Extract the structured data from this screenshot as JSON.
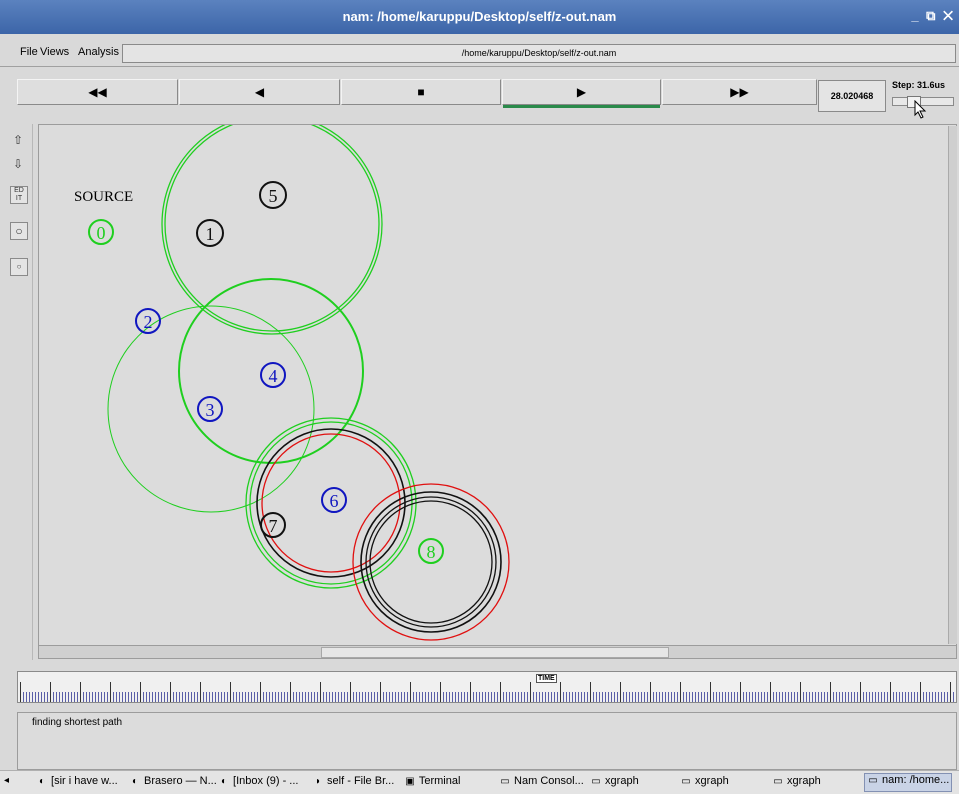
{
  "window": {
    "title": "nam: /home/karuppu/Desktop/self/z-out.nam",
    "controls": "_ ⧉ ✕"
  },
  "menubar": {
    "file": "File",
    "views": "Views",
    "analysis": "Analysis",
    "path": "/home/karuppu/Desktop/self/z-out.nam"
  },
  "controls": {
    "rewind": "◀◀",
    "back": "◀",
    "stop": "■",
    "play": "▶",
    "forward": "▶▶",
    "time": "28.020468",
    "step_label": "Step: 31.6us",
    "step_slider_fraction": 0.3
  },
  "tools": [
    "zoom-in-icon",
    "zoom-out-icon",
    "edit-icon",
    "node-tool-icon",
    "node-small-icon"
  ],
  "canvas": {
    "source_label": "SOURCE",
    "nodes": [
      {
        "id": "0",
        "color": "#1fcf1f"
      },
      {
        "id": "1",
        "color": "#000000"
      },
      {
        "id": "2",
        "color": "#1016c0"
      },
      {
        "id": "3",
        "color": "#1016c0"
      },
      {
        "id": "4",
        "color": "#1016c0"
      },
      {
        "id": "5",
        "color": "#000000"
      },
      {
        "id": "6",
        "color": "#1016c0"
      },
      {
        "id": "7",
        "color": "#000000"
      },
      {
        "id": "8",
        "color": "#1fcf1f"
      }
    ],
    "colors": {
      "green": "#1fcf1f",
      "red": "#e01010",
      "black": "#111111",
      "blue": "#1016c0"
    }
  },
  "timeline": {
    "marker": "TIME"
  },
  "console": {
    "message": "finding shortest path"
  },
  "taskbar": {
    "items": [
      {
        "icon": "◐",
        "label": "[sir i have w..."
      },
      {
        "icon": "◐",
        "label": "Brasero — N..."
      },
      {
        "icon": "◐",
        "label": "[Inbox (9) - ..."
      },
      {
        "icon": "◗",
        "label": "self - File Br..."
      },
      {
        "icon": "▣",
        "label": "Terminal"
      },
      {
        "icon": "▭",
        "label": "Nam Consol..."
      },
      {
        "icon": "▭",
        "label": "xgraph"
      },
      {
        "icon": "▭",
        "label": "xgraph"
      },
      {
        "icon": "▭",
        "label": "xgraph"
      },
      {
        "icon": "▭",
        "label": "nam: /home..."
      }
    ]
  }
}
